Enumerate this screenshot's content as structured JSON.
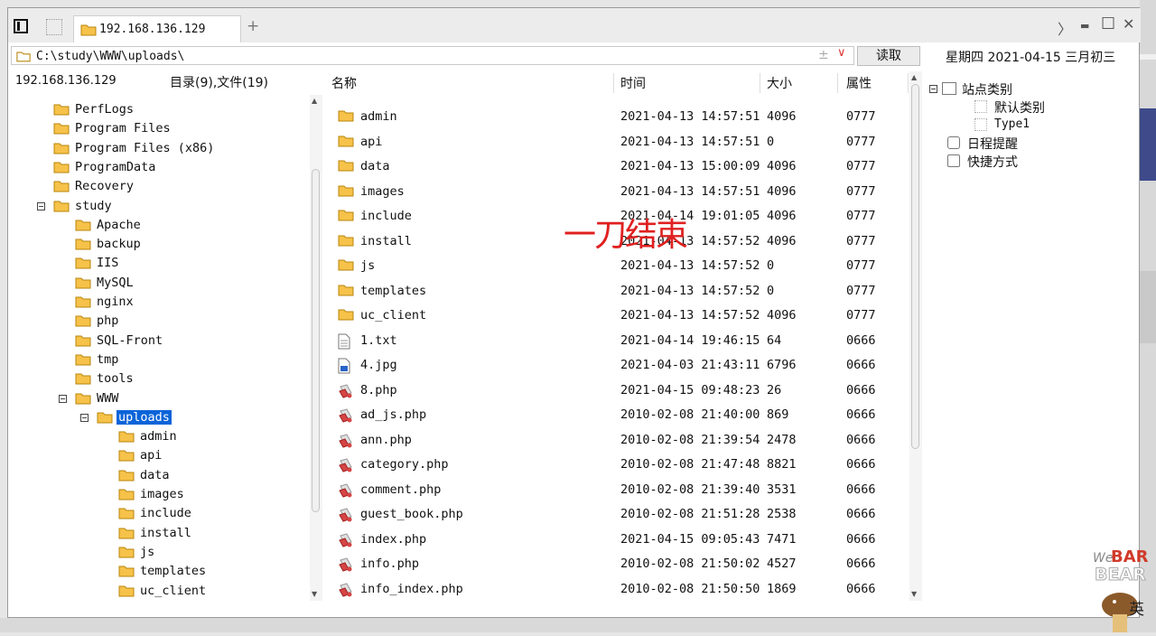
{
  "tab": {
    "title": "192.168.136.129",
    "add": "+"
  },
  "window_controls": {
    "next": "〉",
    "minimize": "▬",
    "maximize": "☐",
    "close": "✕"
  },
  "address": {
    "path": "C:\\study\\WWW\\uploads\\",
    "pm": "±",
    "dropdown": "∨",
    "read_button": "读取"
  },
  "date": "星期四 2021-04-15 三月初三",
  "left_panel": {
    "host": "192.168.136.129",
    "counts": "目录(9),文件(19)"
  },
  "tree": [
    {
      "label": "PerfLogs",
      "level": 1
    },
    {
      "label": "Program Files",
      "level": 1
    },
    {
      "label": "Program Files (x86)",
      "level": 1
    },
    {
      "label": "ProgramData",
      "level": 1
    },
    {
      "label": "Recovery",
      "level": 1
    },
    {
      "label": "study",
      "level": 1,
      "expanded": true
    },
    {
      "label": "Apache",
      "level": 2
    },
    {
      "label": "backup",
      "level": 2
    },
    {
      "label": "IIS",
      "level": 2
    },
    {
      "label": "MySQL",
      "level": 2
    },
    {
      "label": "nginx",
      "level": 2
    },
    {
      "label": "php",
      "level": 2
    },
    {
      "label": "SQL-Front",
      "level": 2
    },
    {
      "label": "tmp",
      "level": 2
    },
    {
      "label": "tools",
      "level": 2
    },
    {
      "label": "WWW",
      "level": 2,
      "expanded": true
    },
    {
      "label": "uploads",
      "level": 3,
      "expanded": true,
      "selected": true
    },
    {
      "label": "admin",
      "level": 4
    },
    {
      "label": "api",
      "level": 4
    },
    {
      "label": "data",
      "level": 4
    },
    {
      "label": "images",
      "level": 4
    },
    {
      "label": "include",
      "level": 4
    },
    {
      "label": "install",
      "level": 4
    },
    {
      "label": "js",
      "level": 4
    },
    {
      "label": "templates",
      "level": 4
    },
    {
      "label": "uc_client",
      "level": 4
    }
  ],
  "columns": {
    "name": "名称",
    "time": "时间",
    "size": "大小",
    "attr": "属性"
  },
  "files": [
    {
      "name": "admin",
      "time": "2021-04-13 14:57:51",
      "size": "4096",
      "attr": "0777",
      "type": "folder"
    },
    {
      "name": "api",
      "time": "2021-04-13 14:57:51",
      "size": "0",
      "attr": "0777",
      "type": "folder"
    },
    {
      "name": "data",
      "time": "2021-04-13 15:00:09",
      "size": "4096",
      "attr": "0777",
      "type": "folder"
    },
    {
      "name": "images",
      "time": "2021-04-13 14:57:51",
      "size": "4096",
      "attr": "0777",
      "type": "folder"
    },
    {
      "name": "include",
      "time": "2021-04-14 19:01:05",
      "size": "4096",
      "attr": "0777",
      "type": "folder"
    },
    {
      "name": "install",
      "time": "2021-04-13 14:57:52",
      "size": "4096",
      "attr": "0777",
      "type": "folder"
    },
    {
      "name": "js",
      "time": "2021-04-13 14:57:52",
      "size": "0",
      "attr": "0777",
      "type": "folder"
    },
    {
      "name": "templates",
      "time": "2021-04-13 14:57:52",
      "size": "0",
      "attr": "0777",
      "type": "folder"
    },
    {
      "name": "uc_client",
      "time": "2021-04-13 14:57:52",
      "size": "4096",
      "attr": "0777",
      "type": "folder"
    },
    {
      "name": "1.txt",
      "time": "2021-04-14 19:46:15",
      "size": "64",
      "attr": "0666",
      "type": "txt"
    },
    {
      "name": "4.jpg",
      "time": "2021-04-03 21:43:11",
      "size": "6796",
      "attr": "0666",
      "type": "img"
    },
    {
      "name": "8.php",
      "time": "2021-04-15 09:48:23",
      "size": "26",
      "attr": "0666",
      "type": "php"
    },
    {
      "name": "ad_js.php",
      "time": "2010-02-08 21:40:00",
      "size": "869",
      "attr": "0666",
      "type": "php"
    },
    {
      "name": "ann.php",
      "time": "2010-02-08 21:39:54",
      "size": "2478",
      "attr": "0666",
      "type": "php"
    },
    {
      "name": "category.php",
      "time": "2010-02-08 21:47:48",
      "size": "8821",
      "attr": "0666",
      "type": "php"
    },
    {
      "name": "comment.php",
      "time": "2010-02-08 21:39:40",
      "size": "3531",
      "attr": "0666",
      "type": "php"
    },
    {
      "name": "guest_book.php",
      "time": "2010-02-08 21:51:28",
      "size": "2538",
      "attr": "0666",
      "type": "php"
    },
    {
      "name": "index.php",
      "time": "2021-04-15 09:05:43",
      "size": "7471",
      "attr": "0666",
      "type": "php"
    },
    {
      "name": "info.php",
      "time": "2010-02-08 21:50:02",
      "size": "4527",
      "attr": "0666",
      "type": "php"
    },
    {
      "name": "info_index.php",
      "time": "2010-02-08 21:50:50",
      "size": "1869",
      "attr": "0666",
      "type": "php"
    }
  ],
  "watermark": "一刀结束",
  "right_panel": {
    "site_category": "站点类别",
    "default_category": "默认类别",
    "type1": "Type1",
    "schedule": "日程提醒",
    "shortcut": "快捷方式"
  },
  "corner_logo": {
    "line1": "We",
    "line2": "BAR",
    "line3": "BEAR",
    "ime": "英"
  },
  "colors": {
    "selection": "#0a64d8",
    "folder": "#f6c24a",
    "watermark": "#e02020",
    "dropdown": "#dd3333"
  }
}
